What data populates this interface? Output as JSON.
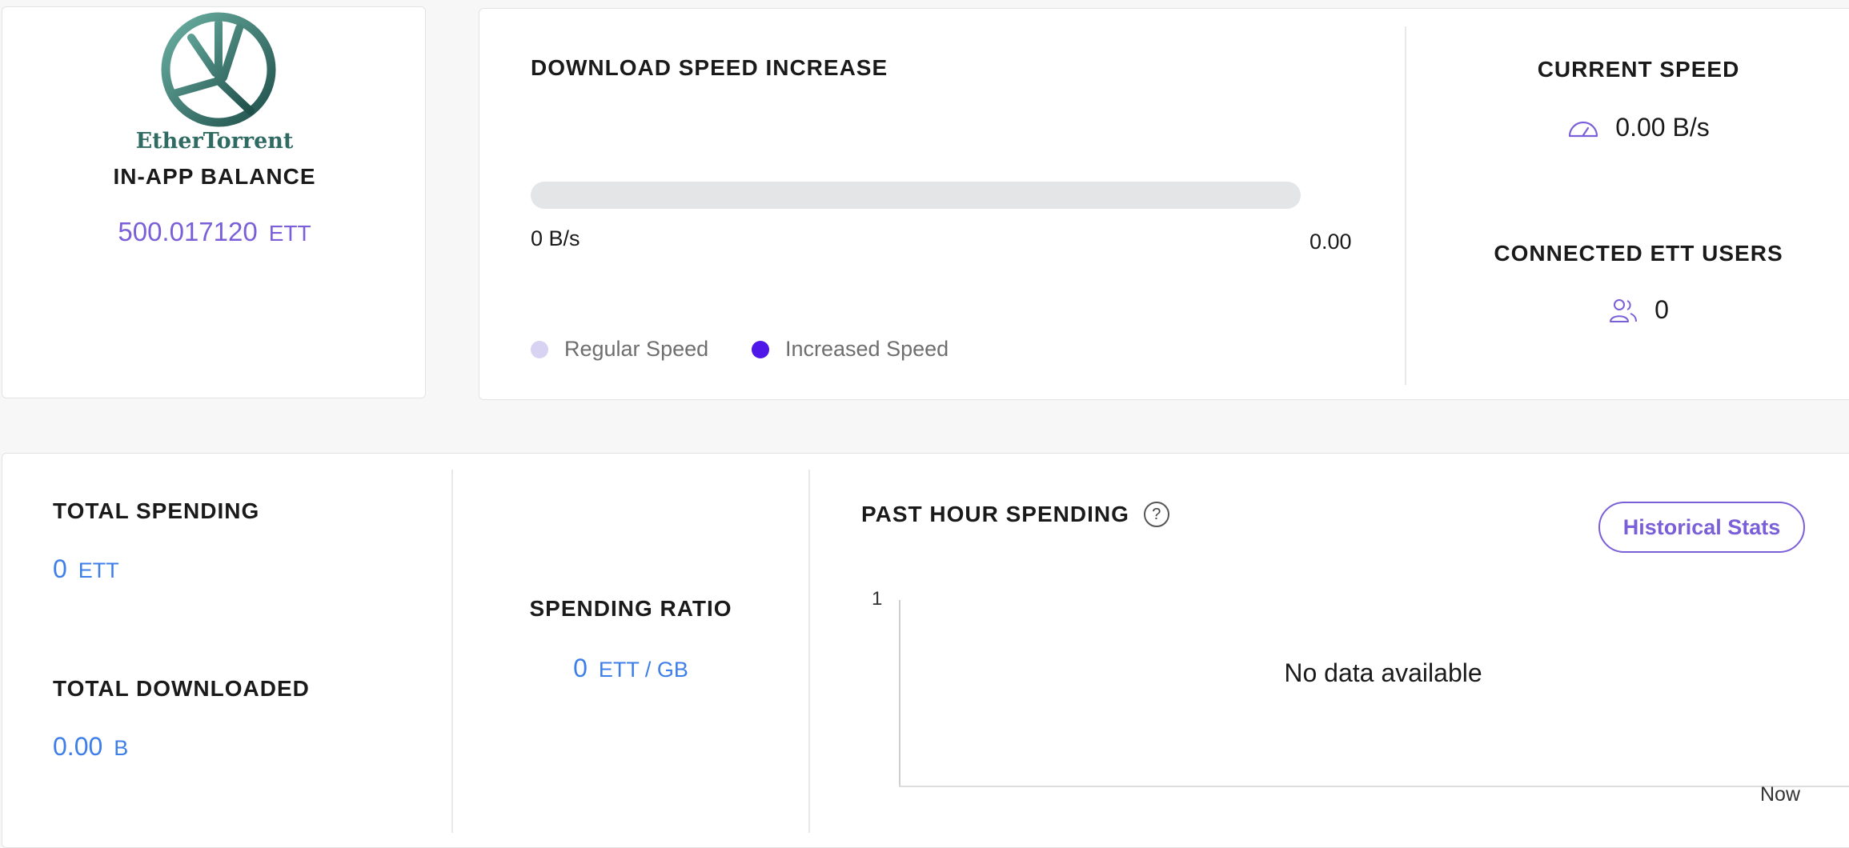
{
  "balance": {
    "logo_text": "EtherTorrent",
    "heading": "IN-APP BALANCE",
    "value": "500.017120",
    "unit": "ETT"
  },
  "speed": {
    "heading": "DOWNLOAD SPEED INCREASE",
    "progress_fraction": 0,
    "min_label": "0 B/s",
    "max_label": "0.00",
    "legend": [
      {
        "label": "Regular Speed",
        "color": "#d9d3f3"
      },
      {
        "label": "Increased Speed",
        "color": "#4f17e8"
      }
    ]
  },
  "current": {
    "heading": "CURRENT SPEED",
    "value": "0.00 B/s",
    "icon": "speedometer-icon"
  },
  "users": {
    "heading": "CONNECTED ETT USERS",
    "value": "0",
    "icon": "users-icon"
  },
  "totals": {
    "spending_heading": "TOTAL SPENDING",
    "spending_value": "0",
    "spending_unit": "ETT",
    "downloaded_heading": "TOTAL DOWNLOADED",
    "downloaded_value": "0.00",
    "downloaded_unit": "B"
  },
  "ratio": {
    "heading": "SPENDING RATIO",
    "value": "0",
    "unit": "ETT / GB"
  },
  "past_hour": {
    "heading": "PAST HOUR SPENDING",
    "help_glyph": "?",
    "button_label": "Historical Stats",
    "y_tick": "1",
    "x_tick": "Now",
    "empty_message": "No data available"
  },
  "colors": {
    "accent_purple": "#7a5fd8",
    "accent_blue": "#3d7ee8",
    "brand_green": "#2f6b63"
  }
}
